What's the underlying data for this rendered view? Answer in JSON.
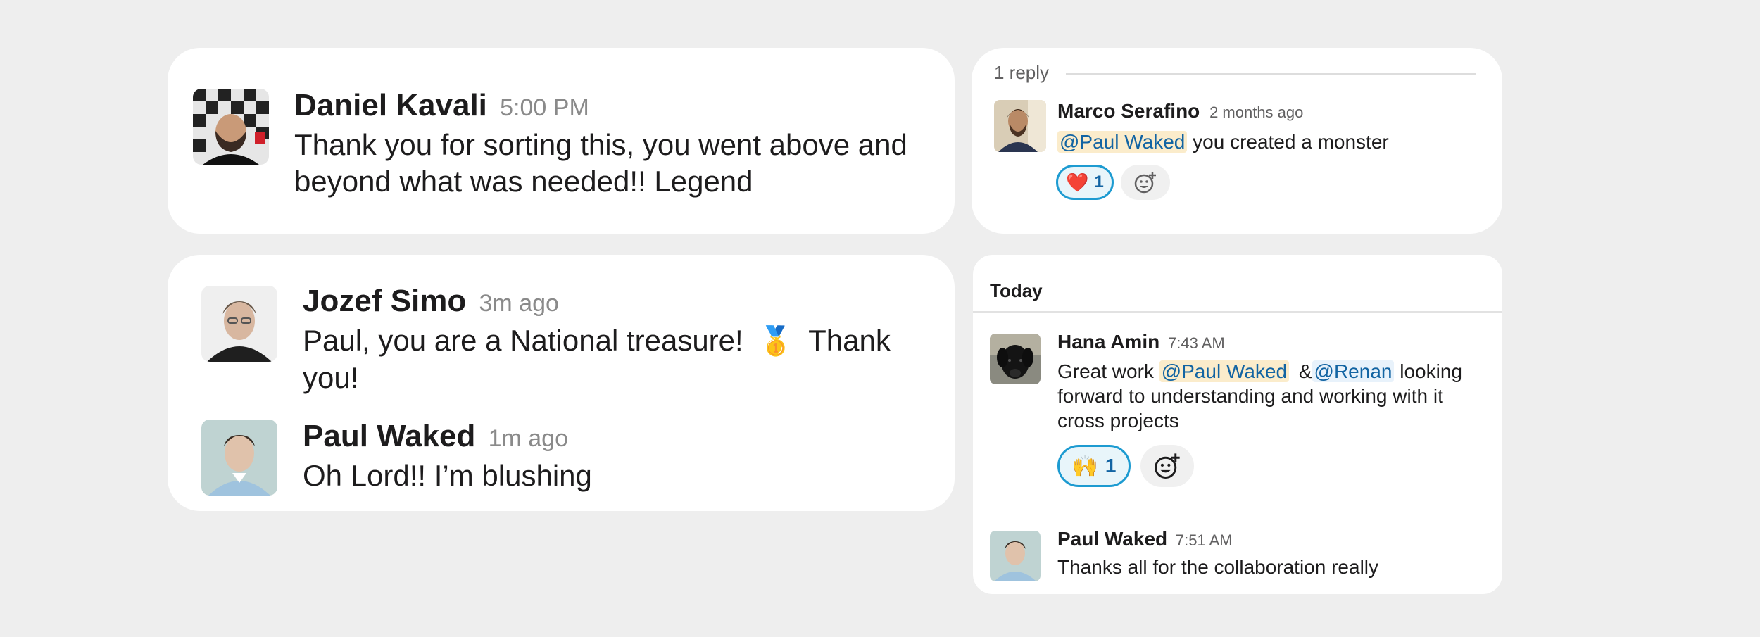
{
  "card1": {
    "author": "Daniel Kavali",
    "time": "5:00 PM",
    "text_line1": "Thank you for sorting this, you went above and",
    "text_line2": "beyond what was needed!! Legend"
  },
  "card2": {
    "reply_count": "1 reply",
    "author": "Marco Serafino",
    "time": "2 months ago",
    "mention": "@Paul Waked",
    "text": " you created a monster",
    "reaction_emoji": "❤️",
    "reaction_count": "1"
  },
  "card3": {
    "messages": [
      {
        "author": "Jozef Simo",
        "time": "3m ago",
        "text_line1a": "Paul, you are a National treasure!",
        "emoji": "🥇",
        "text_line1b": "Thank",
        "text_line2": "you!"
      },
      {
        "author": "Paul Waked",
        "time": "1m ago",
        "text": "Oh Lord!! I’m blushing"
      }
    ]
  },
  "card4": {
    "day_header": "Today",
    "messages": [
      {
        "author": "Hana Amin",
        "time": "7:43 AM",
        "text_start": "Great work ",
        "mention1": "@Paul Waked",
        "text_mid": " &",
        "mention2": "@Renan",
        "text_end": " looking",
        "text_line2": "forward to understanding and working with it",
        "text_line3": "cross projects",
        "reaction_emoji": "🙌",
        "reaction_count": "1"
      },
      {
        "author": "Paul Waked",
        "time": "7:51 AM",
        "text": "Thanks all for the collaboration really"
      }
    ]
  }
}
